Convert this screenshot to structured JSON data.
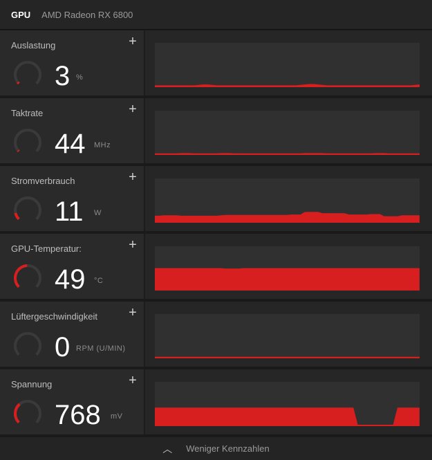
{
  "header": {
    "gpu_label": "GPU",
    "model": "AMD Radeon RX 6800"
  },
  "colors": {
    "accent": "#d81f1f",
    "panel": "#2a2a2a",
    "plot_bg": "#303030"
  },
  "metrics": [
    {
      "label": "Auslastung",
      "value": "3",
      "unit": "%",
      "gauge_fraction": 0.03,
      "history": [
        1,
        1,
        1,
        1,
        1,
        1,
        1,
        1,
        1,
        1,
        2,
        3,
        3,
        2,
        1,
        1,
        1,
        1,
        1,
        1,
        1,
        1,
        1,
        1,
        1,
        1,
        1,
        1,
        1,
        1,
        1,
        1,
        1,
        2,
        3,
        4,
        4,
        3,
        2,
        1,
        1,
        1,
        1,
        1,
        1,
        1,
        1,
        1,
        1,
        1,
        1,
        1,
        1,
        1,
        1,
        1,
        1,
        1,
        1,
        2,
        3
      ],
      "max": 100
    },
    {
      "label": "Taktrate",
      "value": "44",
      "unit": "MHz",
      "gauge_fraction": 0.02,
      "history": [
        0.5,
        0.5,
        0.5,
        0.5,
        0.5,
        0.5,
        1,
        1,
        1,
        0.5,
        0.5,
        0.5,
        0.5,
        0.5,
        0.5,
        1,
        1,
        1,
        0.5,
        0.5,
        0.5,
        0.5,
        0.5,
        0.5,
        0.5,
        0.5,
        0.5,
        0.5,
        0.5,
        0.5,
        0.5,
        0.5,
        0.5,
        0.5,
        1,
        1,
        1,
        1,
        1,
        0.5,
        0.5,
        0.5,
        0.5,
        0.5,
        0.5,
        0.5,
        0.5,
        0.5,
        0.5,
        0.5,
        1,
        1,
        1,
        0.5,
        0.5,
        0.5,
        0.5,
        0.5,
        0.5,
        0.5,
        0.5
      ],
      "max": 100
    },
    {
      "label": "Stromverbrauch",
      "value": "11",
      "unit": "W",
      "gauge_fraction": 0.12,
      "history": [
        13,
        13,
        14,
        14,
        14,
        14,
        13,
        13,
        13,
        13,
        13,
        13,
        13,
        13,
        13,
        14,
        15,
        15,
        15,
        15,
        15,
        15,
        15,
        15,
        15,
        15,
        15,
        15,
        15,
        15,
        15,
        16,
        16,
        16,
        22,
        22,
        22,
        22,
        19,
        19,
        19,
        19,
        19,
        19,
        16,
        16,
        16,
        16,
        16,
        17,
        17,
        17,
        12,
        12,
        12,
        12,
        14,
        14,
        14,
        14,
        14
      ],
      "max": 100
    },
    {
      "label": "GPU-Temperatur:",
      "value": "49",
      "unit": "°C",
      "gauge_fraction": 0.49,
      "history": [
        49,
        49,
        49,
        49,
        49,
        49,
        49,
        49,
        49,
        49,
        49,
        49,
        49,
        49,
        49,
        49,
        48,
        48,
        48,
        48,
        49,
        49,
        49,
        49,
        49,
        49,
        49,
        49,
        49,
        49,
        49,
        49,
        49,
        49,
        49,
        49,
        49,
        49,
        49,
        49,
        49,
        49,
        49,
        49,
        49,
        49,
        49,
        49,
        49,
        49,
        49,
        49,
        49,
        49,
        49,
        49,
        49,
        49,
        49,
        49,
        49
      ],
      "max": 100
    },
    {
      "label": "Lüftergeschwindigkeit",
      "value": "0",
      "unit": "RPM (U/MIN)",
      "gauge_fraction": 0,
      "history": [
        0.3,
        0.3,
        0.3,
        0.3,
        0.3,
        0.3,
        0.3,
        0.3,
        0.3,
        0.3,
        0.3,
        0.3,
        0.3,
        0.3,
        0.3,
        0.3,
        0.3,
        0.3,
        0.3,
        0.3,
        0.3,
        0.3,
        0.3,
        0.3,
        0.3,
        0.3,
        0.3,
        0.3,
        0.3,
        0.3,
        0.3,
        0.3,
        0.3,
        0.3,
        0.3,
        0.3,
        0.3,
        0.3,
        0.3,
        0.3,
        0.3,
        0.3,
        0.3,
        0.3,
        0.3,
        0.3,
        0.3,
        0.3,
        0.3,
        0.3,
        0.3,
        0.3,
        0.3,
        0.3,
        0.3,
        0.3,
        0.3,
        0.3,
        0.3,
        0.3,
        0.3
      ],
      "max": 100
    },
    {
      "label": "Spannung",
      "value": "768",
      "unit": "mV",
      "gauge_fraction": 0.35,
      "history": [
        40,
        40,
        40,
        40,
        40,
        40,
        40,
        40,
        40,
        40,
        40,
        40,
        40,
        40,
        40,
        40,
        40,
        40,
        40,
        40,
        40,
        40,
        40,
        40,
        40,
        40,
        40,
        40,
        40,
        40,
        40,
        40,
        40,
        40,
        40,
        40,
        40,
        40,
        40,
        40,
        40,
        40,
        40,
        40,
        40,
        40,
        0,
        0,
        0,
        0,
        0,
        0,
        0,
        0,
        0,
        40,
        40,
        40,
        40,
        40,
        40
      ],
      "max": 100
    }
  ],
  "footer": {
    "label": "Weniger Kennzahlen"
  }
}
